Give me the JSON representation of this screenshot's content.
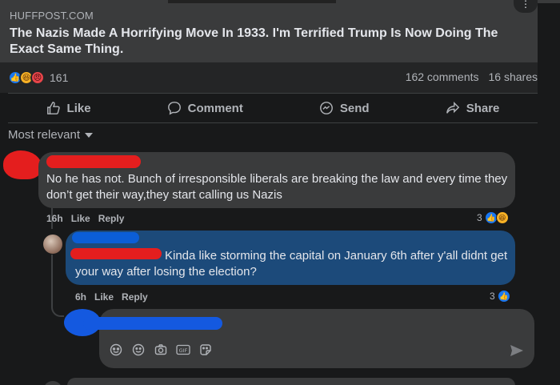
{
  "post": {
    "source": "HUFFPOST.COM",
    "headline": "The Nazis Made A Horrifying Move In 1933. I'm Terrified Trump Is Now Doing The Exact Same Thing.",
    "reaction_count": "161",
    "comments_count": "162 comments",
    "shares_count": "16 shares"
  },
  "actions": {
    "like": "Like",
    "comment": "Comment",
    "send": "Send",
    "share": "Share"
  },
  "sort": {
    "label": "Most relevant"
  },
  "comments": [
    {
      "text_line1": "No he has not. Bunch of irresponsible liberals are breaking the law and every time they",
      "text_line2": "don’t get their way,they start calling us Nazis",
      "time": "16h",
      "like_label": "Like",
      "reply_label": "Reply",
      "reaction_count": "3"
    },
    {
      "text_line1": "Kinda like storming the capital on January 6th after y'all didnt get",
      "text_line2": "your way after losing the election?",
      "time": "6h",
      "like_label": "Like",
      "reply_label": "Reply",
      "reaction_count": "3"
    }
  ],
  "composer": {
    "icons": [
      "sticker-icon",
      "emoji-icon",
      "camera-icon",
      "gif-icon",
      "avatar-sticker-icon",
      "send-icon"
    ]
  },
  "colors": {
    "background": "#18191a",
    "card": "#3a3b3c",
    "reply_highlight": "#1c4a7a",
    "redaction_red": "#e41e1e",
    "redaction_blue": "#1459e0",
    "facebook_blue": "#1877f2"
  }
}
